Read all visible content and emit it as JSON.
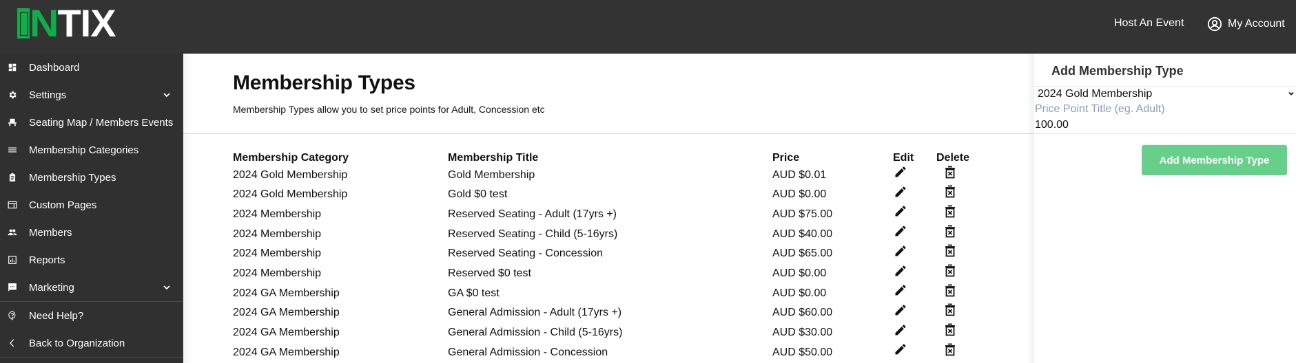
{
  "brand": {
    "logo_accent": "N",
    "logo_text": "TIX",
    "accent_color": "#10ad4b"
  },
  "topbar": {
    "host_event_label": "Host An Event",
    "my_account_label": "My Account",
    "account_icon": "account-circle-icon"
  },
  "sidebar": {
    "items": [
      {
        "label": "Dashboard",
        "icon": "dashboard-icon",
        "has_chevron": false
      },
      {
        "label": "Settings",
        "icon": "gear-icon",
        "has_chevron": true
      },
      {
        "label": "Seating Map / Members Events",
        "icon": "seat-icon",
        "has_chevron": false
      },
      {
        "label": "Membership Categories",
        "icon": "menu-lines-icon",
        "has_chevron": false
      },
      {
        "label": "Membership Types",
        "icon": "clipboard-icon",
        "has_chevron": false
      },
      {
        "label": "Custom Pages",
        "icon": "web-page-icon",
        "has_chevron": false
      },
      {
        "label": "Members",
        "icon": "people-icon",
        "has_chevron": false
      },
      {
        "label": "Reports",
        "icon": "report-chart-icon",
        "has_chevron": false
      },
      {
        "label": "Marketing",
        "icon": "chat-bubble-icon",
        "has_chevron": true
      }
    ],
    "footer_items": [
      {
        "label": "Need Help?",
        "icon": "help-bubble-icon"
      },
      {
        "label": "Back to Organization",
        "icon": "chevron-left-icon"
      }
    ]
  },
  "main": {
    "title": "Membership Types",
    "description": "Membership Types allow you to set price points for Adult, Concession etc",
    "table": {
      "headers": {
        "category": "Membership Category",
        "title": "Membership Title",
        "price": "Price",
        "edit": "Edit",
        "delete": "Delete"
      },
      "rows": [
        {
          "category": "2024 Gold Membership",
          "title": "Gold Membership",
          "price": "AUD $0.01"
        },
        {
          "category": "2024 Gold Membership",
          "title": "Gold $0 test",
          "price": "AUD $0.00"
        },
        {
          "category": "2024 Membership",
          "title": "Reserved Seating - Adult (17yrs +)",
          "price": "AUD $75.00"
        },
        {
          "category": "2024 Membership",
          "title": "Reserved Seating - Child (5-16yrs)",
          "price": "AUD $40.00"
        },
        {
          "category": "2024 Membership",
          "title": "Reserved Seating - Concession",
          "price": "AUD $65.00"
        },
        {
          "category": "2024 Membership",
          "title": "Reserved $0 test",
          "price": "AUD $0.00"
        },
        {
          "category": "2024 GA Membership",
          "title": "GA $0 test",
          "price": "AUD $0.00"
        },
        {
          "category": "2024 GA Membership",
          "title": "General Admission - Adult (17yrs +)",
          "price": "AUD $60.00"
        },
        {
          "category": "2024 GA Membership",
          "title": "General Admission - Child (5-16yrs)",
          "price": "AUD $30.00"
        },
        {
          "category": "2024 GA Membership",
          "title": "General Admission - Concession",
          "price": "AUD $50.00"
        }
      ]
    }
  },
  "panel": {
    "title": "Add Membership Type",
    "category_select": {
      "value": "2024 Gold Membership"
    },
    "title_input": {
      "value": "",
      "placeholder": "Price Point Title (eg. Adult)"
    },
    "price_input": {
      "value": "100.00",
      "placeholder": ""
    },
    "submit_label": "Add Membership Type",
    "submit_color": "#66d08a"
  }
}
